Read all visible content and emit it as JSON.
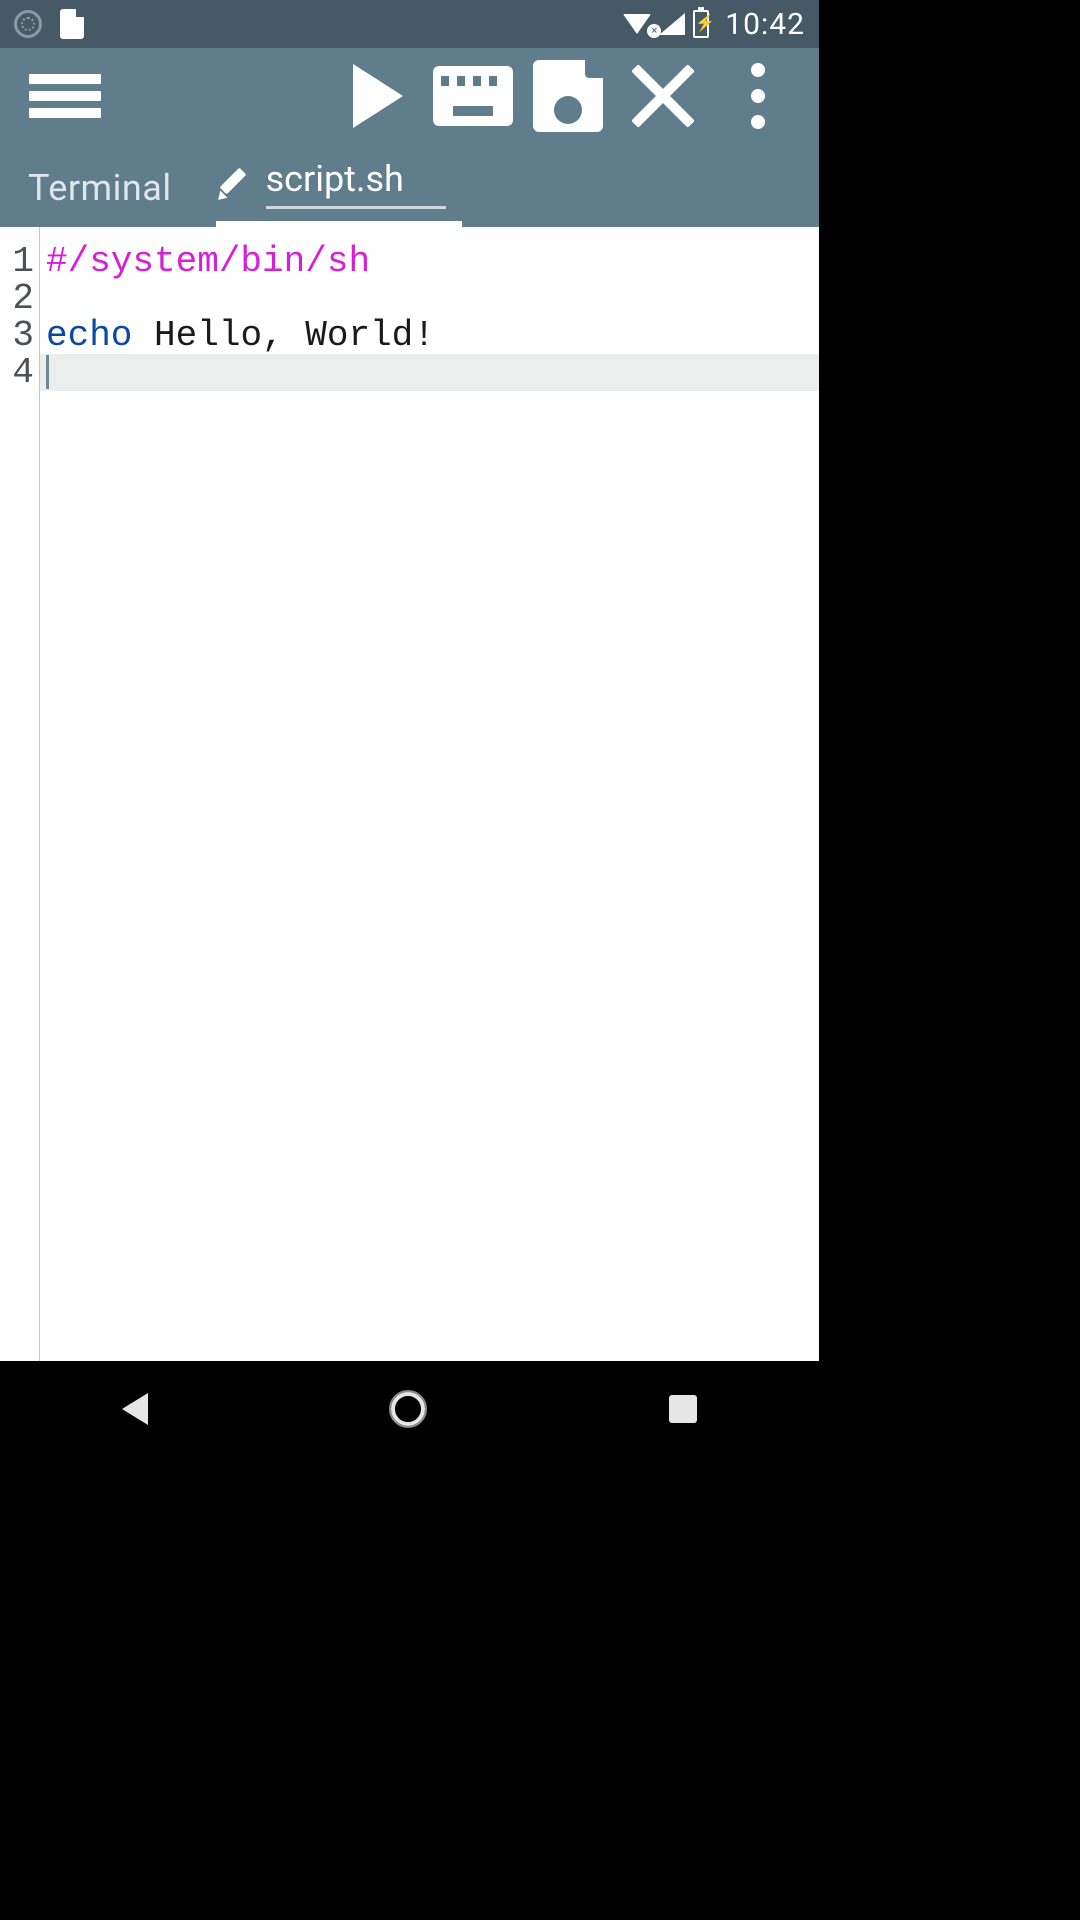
{
  "statusbar": {
    "time": "10:42"
  },
  "tabs": {
    "terminal": "Terminal",
    "filename": "script.sh"
  },
  "editor": {
    "lines": [
      {
        "n": "1",
        "type": "comment",
        "text": "#/system/bin/sh"
      },
      {
        "n": "2",
        "type": "plain",
        "text": ""
      },
      {
        "n": "3",
        "type": "echo",
        "kw": "echo",
        "rest": " Hello, World!"
      },
      {
        "n": "4",
        "type": "plain",
        "text": ""
      }
    ],
    "current_line_index": 3
  }
}
